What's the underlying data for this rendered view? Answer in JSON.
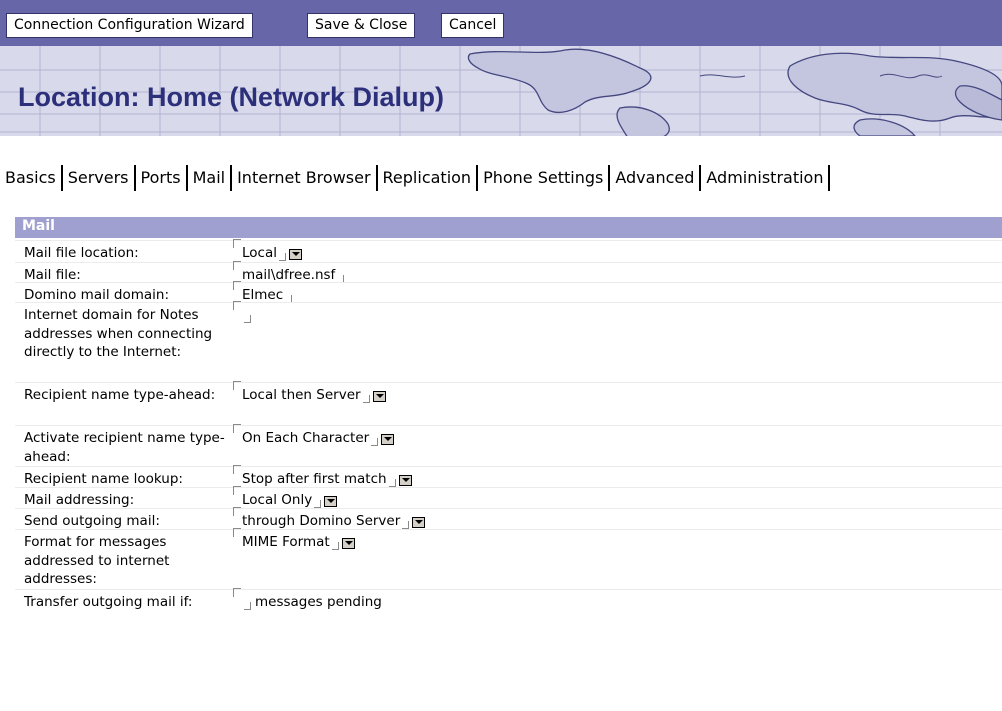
{
  "toolbar": {
    "buttons": [
      "Connection Configuration Wizard",
      "Save & Close",
      "Cancel"
    ]
  },
  "banner": {
    "title": "Location: Home (Network Dialup)"
  },
  "tabs": [
    "Basics",
    "Servers",
    "Ports",
    "Mail",
    "Internet Browser",
    "Replication",
    "Phone Settings",
    "Advanced",
    "Administration"
  ],
  "active_tab": "Mail",
  "section": {
    "title": "Mail"
  },
  "fields": [
    {
      "label": "Mail file location:",
      "value": "Local",
      "dropdown": true
    },
    {
      "label": "Mail file:",
      "value": "mail\\dfree.nsf",
      "dropdown": false
    },
    {
      "label": "Domino mail domain:",
      "value": "Elmec",
      "dropdown": false
    },
    {
      "label": "Internet domain for Notes addresses when connecting directly to the Internet:",
      "value": "",
      "dropdown": false
    },
    {
      "label": "Recipient name type-ahead:",
      "value": "Local then Server",
      "dropdown": true
    },
    {
      "label": "Activate recipient name type-ahead:",
      "value": "On Each Character",
      "dropdown": true
    },
    {
      "label": "Recipient name lookup:",
      "value": "Stop after first match",
      "dropdown": true
    },
    {
      "label": "Mail addressing:",
      "value": "Local Only",
      "dropdown": true
    },
    {
      "label": "Send outgoing mail:",
      "value": "through Domino Server",
      "dropdown": true
    },
    {
      "label": "Format for messages addressed to internet addresses:",
      "value": "MIME Format",
      "dropdown": true
    },
    {
      "label": "Transfer outgoing mail if:",
      "value": "",
      "dropdown": false,
      "suffix": "messages pending"
    }
  ],
  "colors": {
    "toolbar_bg": "#6666a8",
    "banner_bg": "#d8d9ea",
    "banner_title": "#2c2f7a",
    "section_bar": "#9fa0cf"
  }
}
